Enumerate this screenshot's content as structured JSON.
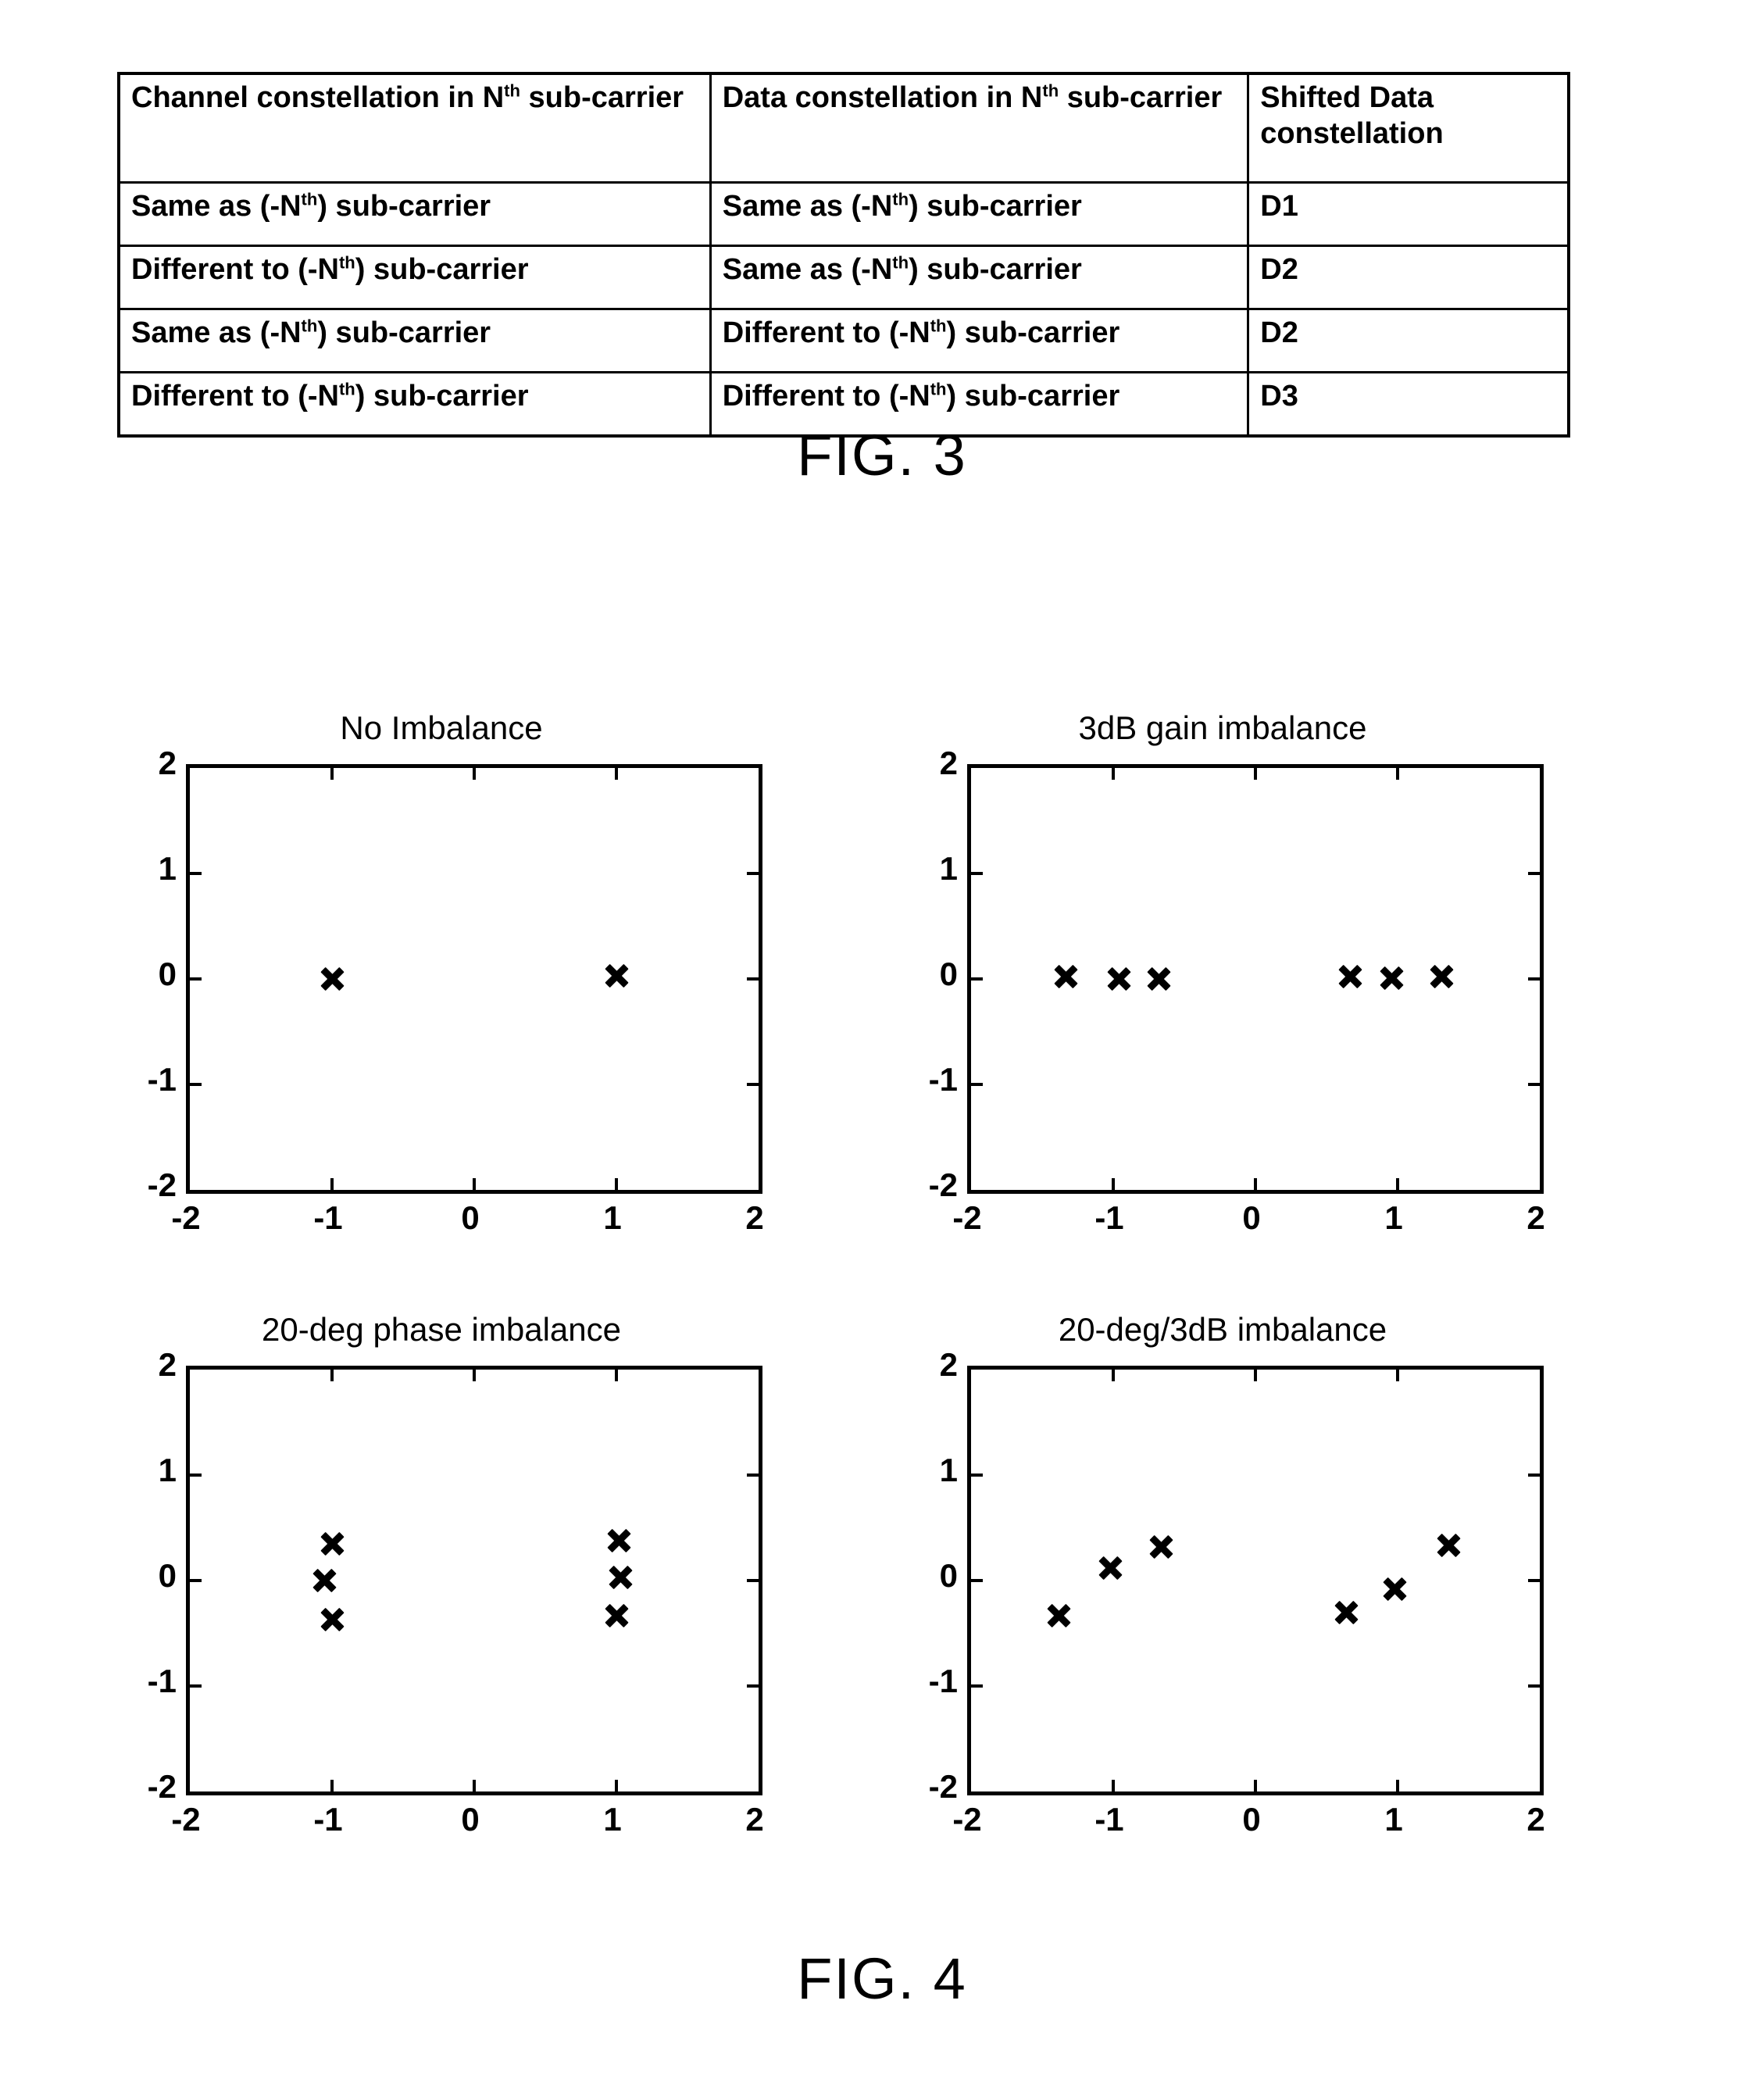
{
  "table": {
    "headers": [
      {
        "pre": "Channel constellation in N",
        "sup": "th",
        "post": " sub-carrier"
      },
      {
        "pre": "Data constellation in N",
        "sup": "th",
        "post": " sub-carrier"
      },
      {
        "pre": "Shifted Data constellation",
        "sup": "",
        "post": ""
      }
    ],
    "rows": [
      {
        "channel": {
          "pre": "Same as (-N",
          "sup": "th",
          "post": ") sub-carrier"
        },
        "data": {
          "pre": "Same as (-N",
          "sup": "th",
          "post": ") sub-carrier"
        },
        "shifted": "D1"
      },
      {
        "channel": {
          "pre": "Different to (-N",
          "sup": "th",
          "post": ") sub-carrier"
        },
        "data": {
          "pre": "Same as (-N",
          "sup": "th",
          "post": ") sub-carrier"
        },
        "shifted": "D2"
      },
      {
        "channel": {
          "pre": "Same as (-N",
          "sup": "th",
          "post": ") sub-carrier"
        },
        "data": {
          "pre": "Different to (-N",
          "sup": "th",
          "post": ") sub-carrier"
        },
        "shifted": "D2"
      },
      {
        "channel": {
          "pre": "Different to (-N",
          "sup": "th",
          "post": ") sub-carrier"
        },
        "data": {
          "pre": "Different to (-N",
          "sup": "th",
          "post": ") sub-carrier"
        },
        "shifted": "D3"
      }
    ]
  },
  "captions": {
    "fig3": "FIG. 3",
    "fig4": "FIG. 4"
  },
  "chart_data": [
    {
      "type": "scatter",
      "title": "No Imbalance",
      "xlabel": "",
      "ylabel": "",
      "xlim": [
        -2,
        2
      ],
      "ylim": [
        -2,
        2
      ],
      "xticks": [
        -2,
        -1,
        0,
        1,
        2
      ],
      "yticks": [
        -2,
        -1,
        0,
        1,
        2
      ],
      "xticklabels": [
        "-2",
        "-1",
        "0",
        "1",
        "2"
      ],
      "yticklabels": [
        "-2",
        "-1",
        "0",
        "1",
        "2"
      ],
      "grid": false,
      "legend": null,
      "marker": "x",
      "points": [
        {
          "x": -1.0,
          "y": 0.0
        },
        {
          "x": 1.0,
          "y": 0.03
        }
      ]
    },
    {
      "type": "scatter",
      "title": "3dB gain imbalance",
      "xlabel": "",
      "ylabel": "",
      "xlim": [
        -2,
        2
      ],
      "ylim": [
        -2,
        2
      ],
      "xticks": [
        -2,
        -1,
        0,
        1,
        2
      ],
      "yticks": [
        -2,
        -1,
        0,
        1,
        2
      ],
      "xticklabels": [
        "-2",
        "-1",
        "0",
        "1",
        "2"
      ],
      "yticklabels": [
        "-2",
        "-1",
        "0",
        "1",
        "2"
      ],
      "grid": false,
      "legend": null,
      "marker": "x",
      "points": [
        {
          "x": -1.33,
          "y": 0.02
        },
        {
          "x": -0.96,
          "y": 0.0
        },
        {
          "x": -0.68,
          "y": 0.0
        },
        {
          "x": 0.67,
          "y": 0.02
        },
        {
          "x": 0.96,
          "y": 0.01
        },
        {
          "x": 1.31,
          "y": 0.02
        }
      ]
    },
    {
      "type": "scatter",
      "title": "20-deg phase imbalance",
      "xlabel": "",
      "ylabel": "",
      "xlim": [
        -2,
        2
      ],
      "ylim": [
        -2,
        2
      ],
      "xticks": [
        -2,
        -1,
        0,
        1,
        2
      ],
      "yticks": [
        -2,
        -1,
        0,
        1,
        2
      ],
      "xticklabels": [
        "-2",
        "-1",
        "0",
        "1",
        "2"
      ],
      "yticklabels": [
        "-2",
        "-1",
        "0",
        "1",
        "2"
      ],
      "grid": false,
      "legend": null,
      "marker": "x",
      "points": [
        {
          "x": -1.0,
          "y": 0.35
        },
        {
          "x": -1.05,
          "y": 0.0
        },
        {
          "x": -1.0,
          "y": -0.37
        },
        {
          "x": 1.02,
          "y": 0.38
        },
        {
          "x": 1.03,
          "y": 0.03
        },
        {
          "x": 1.0,
          "y": -0.33
        }
      ]
    },
    {
      "type": "scatter",
      "title": "20-deg/3dB imbalance",
      "xlabel": "",
      "ylabel": "",
      "xlim": [
        -2,
        2
      ],
      "ylim": [
        -2,
        2
      ],
      "xticks": [
        -2,
        -1,
        0,
        1,
        2
      ],
      "yticks": [
        -2,
        -1,
        0,
        1,
        2
      ],
      "xticklabels": [
        "-2",
        "-1",
        "0",
        "1",
        "2"
      ],
      "yticklabels": [
        "-2",
        "-1",
        "0",
        "1",
        "2"
      ],
      "grid": false,
      "legend": null,
      "marker": "x",
      "points": [
        {
          "x": -1.38,
          "y": -0.33
        },
        {
          "x": -1.02,
          "y": 0.12
        },
        {
          "x": -0.66,
          "y": 0.32
        },
        {
          "x": 0.64,
          "y": -0.3
        },
        {
          "x": 0.98,
          "y": -0.08
        },
        {
          "x": 1.36,
          "y": 0.33
        }
      ]
    }
  ],
  "colors": {
    "ink": "#000000",
    "paper": "#ffffff"
  }
}
